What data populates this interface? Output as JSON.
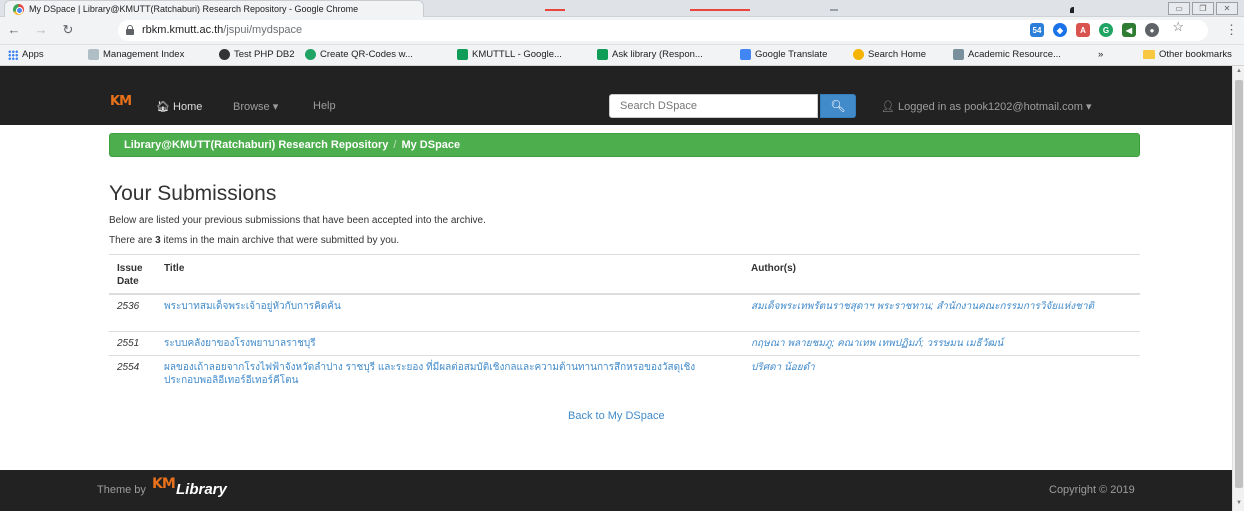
{
  "browser": {
    "window_title": "My DSpace | Library@KMUTT(Ratchaburi) Research Repository - Google Chrome",
    "url_host": "rbkm.kmutt.ac.th",
    "url_path": "/jspui/mydspace",
    "bookmarks": [
      {
        "label": "Apps",
        "icon": "apps-grid-icon"
      },
      {
        "label": "Management Index",
        "icon": "page-icon"
      },
      {
        "label": "Test PHP DB2",
        "icon": "globe-icon"
      },
      {
        "label": "Create QR-Codes w...",
        "icon": "qr-icon"
      },
      {
        "label": "KMUTTLL - Google...",
        "icon": "sheets-icon"
      },
      {
        "label": "Ask library (Respon...",
        "icon": "sheets-icon"
      },
      {
        "label": "Google Translate",
        "icon": "translate-icon"
      },
      {
        "label": "Search Home",
        "icon": "search-icon"
      },
      {
        "label": "Academic Resource...",
        "icon": "page-icon"
      }
    ],
    "more_bookmarks": "»",
    "other_bookmarks": "Other bookmarks"
  },
  "navbar": {
    "logo_text": "KM",
    "home": "Home",
    "browse": "Browse",
    "help": "Help",
    "search_placeholder": "Search DSpace",
    "user": "Logged in as pook1202@hotmail.com"
  },
  "breadcrumb": {
    "root": "Library@KMUTT(Ratchaburi) Research Repository",
    "current": "My DSpace"
  },
  "main": {
    "heading": "Your Submissions",
    "intro": "Below are listed your previous submissions that have been accepted into the archive.",
    "count_prefix": "There are ",
    "count": "3",
    "count_suffix": " items in the main archive that were submitted by you.",
    "columns": {
      "date": "Issue Date",
      "title": "Title",
      "author": "Author(s)"
    },
    "rows": [
      {
        "date": "2536",
        "title": "พระบาทสมเด็จพระเจ้าอยู่หัวกับการคิดค้น",
        "author": "สมเด็จพระเทพรัตนราชสุดาฯ พระราชทาน; สำนักงานคณะกรรมการวิจัยแห่งชาติ"
      },
      {
        "date": "2551",
        "title": "ระบบคลังยาของโรงพยาบาลราชบุรี",
        "author": "กฤษณา พลายชมภู; คณาเทพ เทพปฏิมภ์; วรรษมน เมธีวัฒน์"
      },
      {
        "date": "2554",
        "title": "ผลของเถ้าลอยจากโรงไฟฟ้าจังหวัดลำปาง ราชบุรี และระยอง ที่มีผลต่อสมบัติเชิงกลและความต้านทานการสึกหรอของวัสดุเชิงประกอบพอลิอีเทอร์อีเทอร์คีโตน",
        "author": "ปริศดา น้อยดำ"
      }
    ],
    "back_link": "Back to My DSpace"
  },
  "footer": {
    "theme_by": "Theme by",
    "logo_text": "KM",
    "library": "Library",
    "copyright": "Copyright © 2019"
  }
}
